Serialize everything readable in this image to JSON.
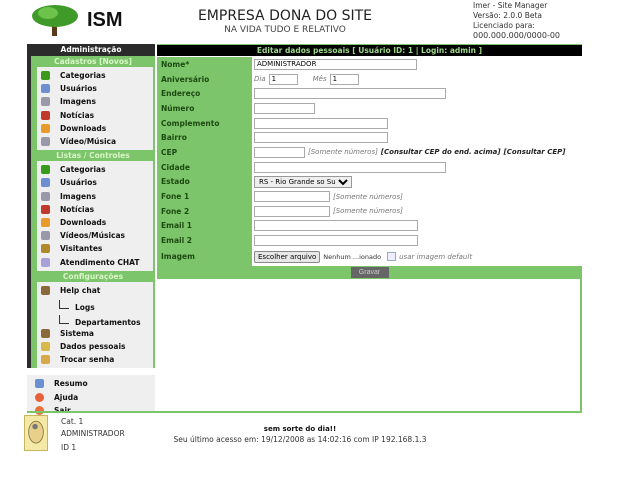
{
  "header": {
    "logo_text": "ISM",
    "site_title": "EMPRESA DONA DO SITE",
    "site_subtitle": "NA VIDA TUDO E RELATIVO",
    "info": [
      "Imer - Site Manager",
      "Versão: 2.0.0 Beta",
      "Licenciado para:",
      "000.000.000/0000-00"
    ]
  },
  "sidebar": {
    "title": "Administração",
    "sections": [
      {
        "title": "Cadastros [Novos]",
        "items": [
          {
            "label": "Categorias",
            "icon": "category-icon",
            "color": "#3a9a1a"
          },
          {
            "label": "Usuários",
            "icon": "user-icon",
            "color": "#6b8fd0"
          },
          {
            "label": "Imagens",
            "icon": "image-icon",
            "color": "#99a"
          },
          {
            "label": "Notícias",
            "icon": "news-icon",
            "color": "#c0392b"
          },
          {
            "label": "Downloads",
            "icon": "download-icon",
            "color": "#e89a2a"
          },
          {
            "label": "Vídeo/Música",
            "icon": "video-icon",
            "color": "#99a"
          }
        ]
      },
      {
        "title": "Listas / Controles",
        "items": [
          {
            "label": "Categorias",
            "icon": "category-icon",
            "color": "#3a9a1a"
          },
          {
            "label": "Usuários",
            "icon": "user-icon",
            "color": "#6b8fd0"
          },
          {
            "label": "Imagens",
            "icon": "image-icon",
            "color": "#99a"
          },
          {
            "label": "Notícias",
            "icon": "news-icon",
            "color": "#c0392b"
          },
          {
            "label": "Downloads",
            "icon": "download-icon",
            "color": "#e89a2a"
          },
          {
            "label": "Vídeos/Músicas",
            "icon": "video-icon",
            "color": "#99a"
          },
          {
            "label": "Visitantes",
            "icon": "visitors-icon",
            "color": "#b08a2a"
          },
          {
            "label": "Atendimento CHAT",
            "icon": "chat-icon",
            "color": "#a8a0d8"
          }
        ]
      },
      {
        "title": "Configurações",
        "items": [
          {
            "label": "Help chat",
            "icon": "tools-icon",
            "color": "#8a6a3a"
          },
          {
            "label": "Logs"
          },
          {
            "label": "Departamentos"
          },
          {
            "label": "Sistema",
            "icon": "tools-icon",
            "color": "#8a6a3a"
          },
          {
            "label": "Dados pessoais",
            "icon": "personal-data-icon",
            "color": "#d8b84a"
          },
          {
            "label": "Trocar senha",
            "icon": "lock-icon",
            "color": "#d8a84a"
          }
        ]
      }
    ],
    "bottom": [
      {
        "label": "Resumo",
        "icon": "summary-icon",
        "color": "#6b8fd0"
      },
      {
        "label": "Ajuda",
        "icon": "help-icon",
        "color": "#e8603a"
      },
      {
        "label": "Sair",
        "icon": "exit-icon",
        "color": "#e8703a"
      }
    ]
  },
  "form": {
    "title": "Editar dados pessoais [ Usuário ID: 1 | Login: admin ]",
    "labels": {
      "nome": "Nome*",
      "aniversario": "Aniversário",
      "endereco": "Endereço",
      "numero": "Número",
      "complemento": "Complemento",
      "bairro": "Bairro",
      "cep": "CEP",
      "cidade": "Cidade",
      "estado": "Estado",
      "fone1": "Fone 1",
      "fone2": "Fone 2",
      "email1": "Email 1",
      "email2": "Email 2",
      "imagem": "Imagem"
    },
    "values": {
      "nome": "ADMINISTRADOR",
      "dia": "1",
      "mes": "1",
      "endereco": "",
      "numero": "",
      "complemento": "",
      "bairro": "",
      "cep": "",
      "cidade": "",
      "estado": "RS - Rio Grande so Sul",
      "fone1": "",
      "fone2": "",
      "email1": "",
      "email2": ""
    },
    "dia_label": "Dia",
    "mes_label": "Mês",
    "hint_numbers": "[Somente números]",
    "cep_link1": "[Consultar CEP do end. acima]",
    "cep_link2": "[Consultar CEP]",
    "file_button": "Escolher arquivo",
    "file_status": "Nenhum ...ionado",
    "default_image_label": "usar imagem default",
    "submit": "Gravar"
  },
  "footer": {
    "cat": "Cat. 1",
    "name": "ADMINISTRADOR",
    "id": "ID 1",
    "motd": "sem sorte do dia!!",
    "last_access": "Seu último acesso em: 19/12/2008 as 14:02:16 com IP 192.168.1.3"
  }
}
